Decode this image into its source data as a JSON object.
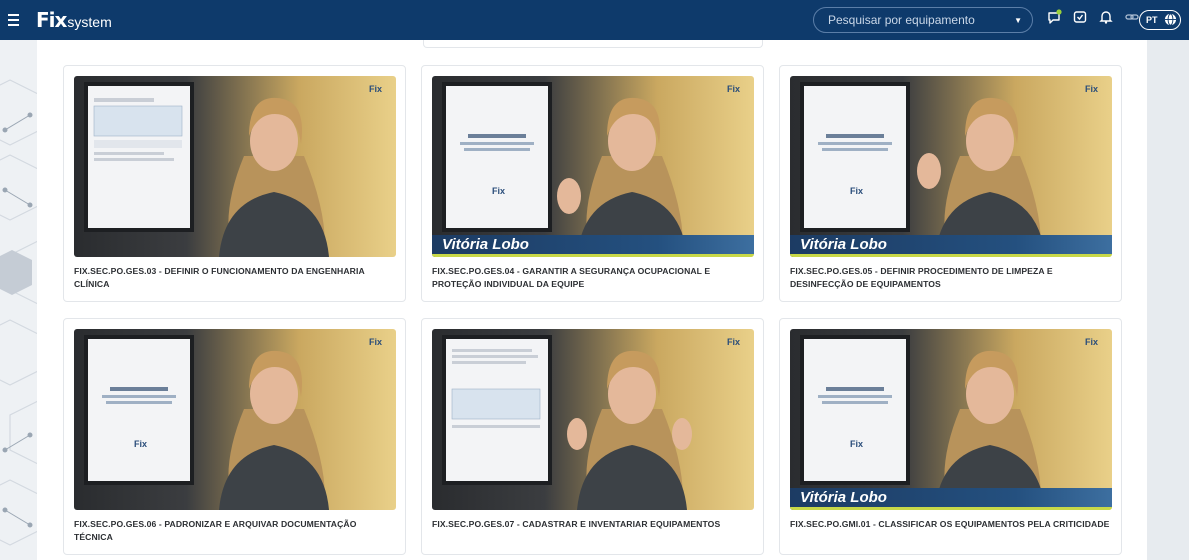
{
  "app": {
    "logo_mark": "Fix",
    "logo_text": "system"
  },
  "search": {
    "placeholder": "Pesquisar por equipamento"
  },
  "language": {
    "code": "PT"
  },
  "icons": {
    "menu": "hamburger-icon",
    "chat": "chat-icon",
    "tasks": "checklist-icon",
    "notifications": "bell-icon",
    "link": "link-icon",
    "language": "globe-icon",
    "search_caret": "chevron-down-icon"
  },
  "colors": {
    "topbar": "#0e3a6b",
    "nameplate_accent": "#c8d848",
    "notification_dot": "#9ad13b"
  },
  "videos": [
    {
      "title": "FIX.SEC.PO.GES.03 - DEFINIR O FUNCIONAMENTO DA ENGENHARIA CLÍNICA",
      "presenter": ""
    },
    {
      "title": "FIX.SEC.PO.GES.04 - GARANTIR A SEGURANÇA OCUPACIONAL E PROTEÇÃO INDIVIDUAL DA EQUIPE",
      "presenter": "Vitória Lobo"
    },
    {
      "title": "FIX.SEC.PO.GES.05 - DEFINIR PROCEDIMENTO DE LIMPEZA E DESINFECÇÃO DE EQUIPAMENTOS",
      "presenter": "Vitória Lobo"
    },
    {
      "title": "FIX.SEC.PO.GES.06 - PADRONIZAR E ARQUIVAR DOCUMENTAÇÃO TÉCNICA",
      "presenter": ""
    },
    {
      "title": "FIX.SEC.PO.GES.07 - CADASTRAR E INVENTARIAR EQUIPAMENTOS",
      "presenter": ""
    },
    {
      "title": "FIX.SEC.PO.GMI.01 - CLASSIFICAR OS EQUIPAMENTOS PELA CRITICIDADE",
      "presenter": "Vitória Lobo"
    }
  ]
}
